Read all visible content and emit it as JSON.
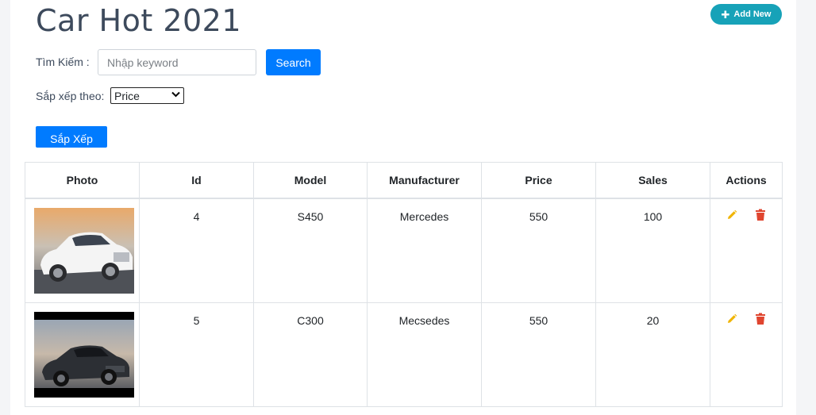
{
  "header": {
    "title": "Car Hot 2021",
    "add_new_label": "Add New"
  },
  "search": {
    "label": "Tìm Kiếm :",
    "placeholder": "Nhập keyword",
    "button_label": "Search"
  },
  "sort": {
    "label": "Sắp xếp theo:",
    "selected": "Price",
    "button_label": "Sắp Xếp"
  },
  "table": {
    "columns": [
      "Photo",
      "Id",
      "Model",
      "Manufacturer",
      "Price",
      "Sales",
      "Actions"
    ],
    "rows": [
      {
        "photo": "white-sedan-photo",
        "id": "4",
        "model": "S450",
        "manufacturer": "Mercedes",
        "price": "550",
        "sales": "100"
      },
      {
        "photo": "dark-coupe-photo",
        "id": "5",
        "model": "C300",
        "manufacturer": "Mecsedes",
        "price": "550",
        "sales": "20"
      }
    ]
  },
  "colors": {
    "primary": "#007bff",
    "info": "#17a2b8",
    "edit_icon": "#f0b400",
    "delete_icon": "#e0452f"
  },
  "icons": [
    "plus-icon",
    "pencil-icon",
    "trash-icon",
    "chevron-down-icon"
  ]
}
